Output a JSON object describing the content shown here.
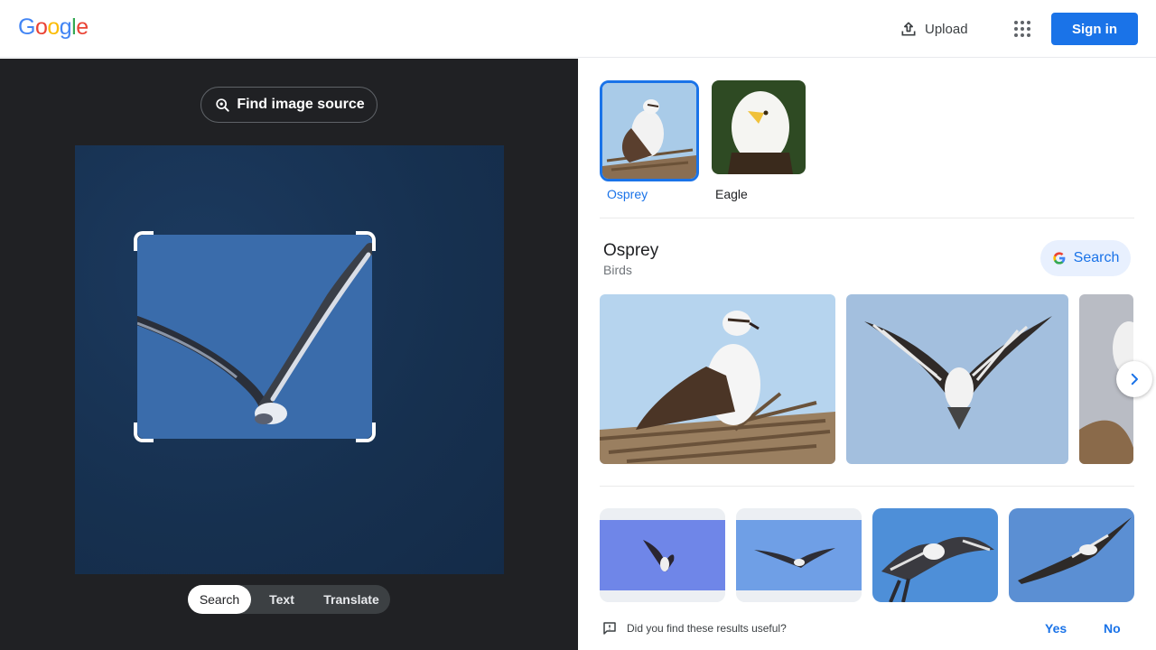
{
  "header": {
    "logo_letters": [
      "G",
      "o",
      "o",
      "g",
      "l",
      "e"
    ],
    "logo_colors": [
      "#4285F4",
      "#EA4335",
      "#FBBC05",
      "#4285F4",
      "#34A853",
      "#EA4335"
    ],
    "upload_label": "Upload",
    "signin_label": "Sign in"
  },
  "lens": {
    "find_source_label": "Find image source",
    "modes": [
      {
        "label": "Search",
        "active": true
      },
      {
        "label": "Text",
        "active": false
      },
      {
        "label": "Translate",
        "active": false
      }
    ]
  },
  "results": {
    "chips": [
      {
        "label": "Osprey",
        "selected": true
      },
      {
        "label": "Eagle",
        "selected": false
      }
    ],
    "entity": {
      "title": "Osprey",
      "subtitle": "Birds",
      "search_label": "Search"
    },
    "feedback": {
      "question": "Did you find these results useful?",
      "yes": "Yes",
      "no": "No"
    }
  },
  "colors": {
    "accent": "#1a73e8",
    "dark_pane": "#202124"
  }
}
